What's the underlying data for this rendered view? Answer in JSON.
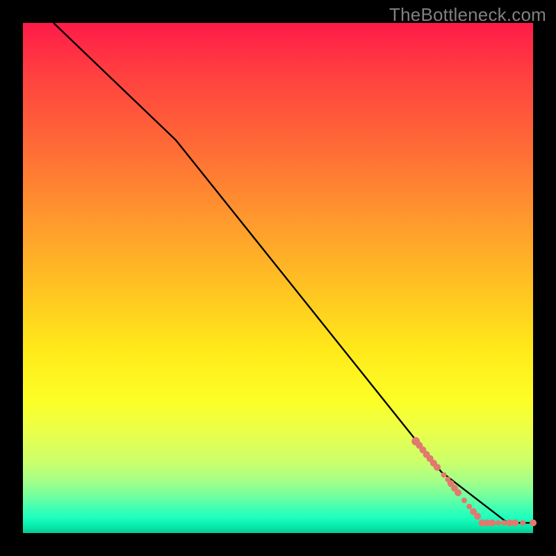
{
  "watermark": "TheBottleneck.com",
  "chart_data": {
    "type": "line",
    "title": "",
    "xlabel": "",
    "ylabel": "",
    "xlim": [
      0,
      100
    ],
    "ylim": [
      0,
      100
    ],
    "line": {
      "x": [
        6,
        30,
        82,
        95,
        100
      ],
      "y": [
        100,
        77,
        12,
        2,
        2
      ],
      "color": "#000000"
    },
    "markers": {
      "color": "#e07a6e",
      "radius": 4.5,
      "points": [
        {
          "x": 77.0,
          "y": 18.0,
          "r": 6
        },
        {
          "x": 77.7,
          "y": 17.2,
          "r": 5
        },
        {
          "x": 78.4,
          "y": 16.3,
          "r": 5
        },
        {
          "x": 79.1,
          "y": 15.4,
          "r": 5
        },
        {
          "x": 79.8,
          "y": 14.6,
          "r": 5
        },
        {
          "x": 80.5,
          "y": 13.7,
          "r": 5
        },
        {
          "x": 81.2,
          "y": 12.9,
          "r": 5
        },
        {
          "x": 82.5,
          "y": 11.4,
          "r": 4
        },
        {
          "x": 83.3,
          "y": 10.5,
          "r": 4
        },
        {
          "x": 83.9,
          "y": 9.7,
          "r": 5
        },
        {
          "x": 84.6,
          "y": 8.8,
          "r": 5
        },
        {
          "x": 85.3,
          "y": 7.9,
          "r": 5
        },
        {
          "x": 86.5,
          "y": 6.4,
          "r": 4
        },
        {
          "x": 87.5,
          "y": 5.2,
          "r": 4
        },
        {
          "x": 88.3,
          "y": 4.2,
          "r": 5
        },
        {
          "x": 89.1,
          "y": 3.3,
          "r": 5
        },
        {
          "x": 90.0,
          "y": 2.0,
          "r": 5
        },
        {
          "x": 91.0,
          "y": 2.0,
          "r": 5
        },
        {
          "x": 92.0,
          "y": 2.0,
          "r": 5
        },
        {
          "x": 93.2,
          "y": 2.0,
          "r": 4
        },
        {
          "x": 94.3,
          "y": 2.0,
          "r": 4
        },
        {
          "x": 95.4,
          "y": 2.0,
          "r": 5
        },
        {
          "x": 96.5,
          "y": 2.0,
          "r": 5
        },
        {
          "x": 98.0,
          "y": 2.0,
          "r": 4
        },
        {
          "x": 100.0,
          "y": 2.0,
          "r": 5
        }
      ]
    }
  }
}
